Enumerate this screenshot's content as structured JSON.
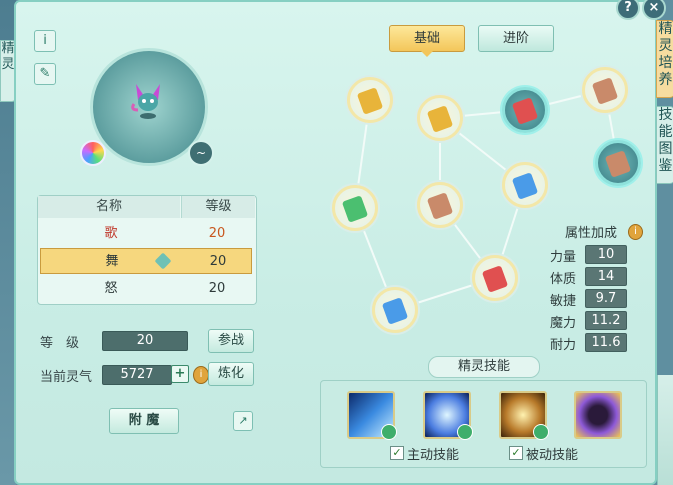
{
  "left_sidetab": {
    "label": "精灵"
  },
  "header_icons": {
    "help": "?",
    "close": "×"
  },
  "tools": {
    "info": "i",
    "edit": "✎"
  },
  "table": {
    "headers": [
      "名称",
      "等级"
    ],
    "rows": [
      {
        "name": "歌",
        "level": "20",
        "highlight": false
      },
      {
        "name": "舞",
        "level": "20",
        "highlight": true
      },
      {
        "name": "怒",
        "level": "20",
        "highlight": false
      }
    ]
  },
  "level_label": "等　级",
  "level_value": "20",
  "join_button": "参战",
  "energy_label": "当前灵气",
  "energy_value": "5727",
  "refine_button": "炼化",
  "enchant_button": "附 魔",
  "tabs": {
    "basic": "基础",
    "advanced": "进阶"
  },
  "attributes": {
    "title": "属性加成",
    "items": [
      {
        "label": "力量",
        "value": "10"
      },
      {
        "label": "体质",
        "value": "14"
      },
      {
        "label": "敏捷",
        "value": "9.7"
      },
      {
        "label": "魔力",
        "value": "11.2"
      },
      {
        "label": "耐力",
        "value": "11.6"
      }
    ]
  },
  "skill_section": {
    "title": "精灵技能",
    "active_label": "主动技能",
    "passive_label": "被动技能"
  },
  "right_tabs": [
    "精灵培养",
    "技能图鉴"
  ],
  "colors": {
    "accent_gold": "#f6d77e",
    "panel_bg": "#d8f5ee",
    "red_text": "#c0392b",
    "orange_value": "#c8561d"
  }
}
